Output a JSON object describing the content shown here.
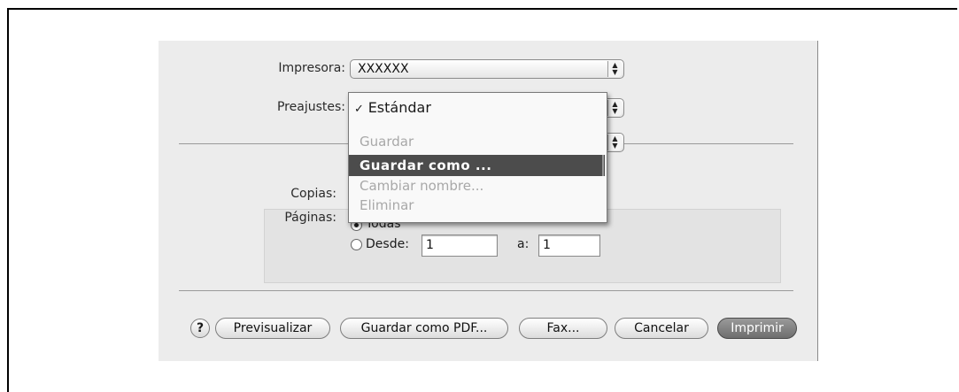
{
  "printer": {
    "label": "Impresora:",
    "value": "XXXXXX"
  },
  "presets": {
    "label": "Preajustes:",
    "menu": {
      "checkmark": "✓",
      "selected": "Estándar",
      "items": [
        "Guardar",
        "Guardar como ...",
        "Cambiar nombre...",
        "Eliminar"
      ],
      "highlighted_index": 1
    }
  },
  "copies": {
    "label": "Copias:"
  },
  "pages": {
    "label": "Páginas:",
    "all_label": "Todas",
    "from_label": "Desde:",
    "from_value": "1",
    "to_label": "a:",
    "to_value": "1"
  },
  "buttons": {
    "help": "?",
    "preview": "Previsualizar",
    "save_pdf": "Guardar como PDF...",
    "fax": "Fax...",
    "cancel": "Cancelar",
    "print": "Imprimir"
  }
}
